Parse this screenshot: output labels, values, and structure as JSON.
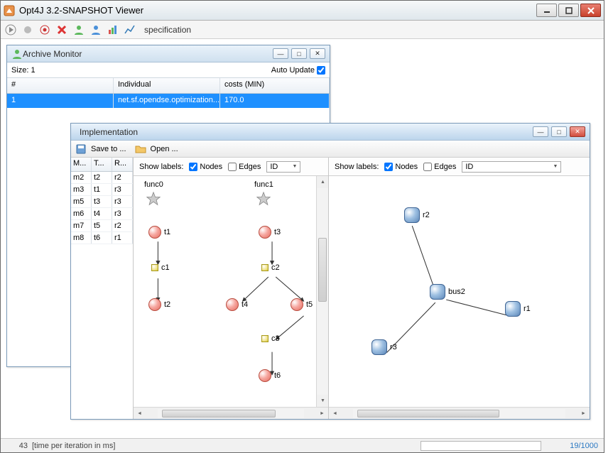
{
  "window": {
    "title": "Opt4J 3.2-SNAPSHOT Viewer"
  },
  "toolbar": {
    "specification_label": "specification"
  },
  "status": {
    "time_value": "43",
    "time_label": "[time per iteration in ms]",
    "progress": "19/1000"
  },
  "archive": {
    "title": "Archive Monitor",
    "size_label": "Size:",
    "size_value": "1",
    "auto_update_label": "Auto Update",
    "columns": {
      "num": "#",
      "individual": "Individual",
      "costs": "costs (MIN)"
    },
    "rows": [
      {
        "num": "1",
        "individual": "net.sf.opendse.optimization...",
        "costs": "170.0"
      }
    ]
  },
  "impl": {
    "title": "Implementation",
    "save_label": "Save to ...",
    "open_label": "Open ...",
    "show_labels": "Show labels:",
    "nodes_label": "Nodes",
    "edges_label": "Edges",
    "id_option": "ID",
    "left_table": {
      "headers": {
        "m": "M...",
        "t": "T...",
        "r": "R..."
      },
      "rows": [
        {
          "m": "m2",
          "t": "t2",
          "r": "r2"
        },
        {
          "m": "m3",
          "t": "t1",
          "r": "r3"
        },
        {
          "m": "m5",
          "t": "t3",
          "r": "r3"
        },
        {
          "m": "m6",
          "t": "t4",
          "r": "r3"
        },
        {
          "m": "m7",
          "t": "t5",
          "r": "r2"
        },
        {
          "m": "m8",
          "t": "t6",
          "r": "r1"
        }
      ]
    },
    "graph1": {
      "funcs": {
        "f0": "func0",
        "f1": "func1"
      },
      "nodes": {
        "t1": "t1",
        "t2": "t2",
        "t3": "t3",
        "t4": "t4",
        "t5": "t5",
        "t6": "t6",
        "c1": "c1",
        "c2": "c2",
        "c3": "c3"
      }
    },
    "graph2": {
      "nodes": {
        "r1": "r1",
        "r2": "r2",
        "r3": "r3",
        "bus2": "bus2"
      }
    }
  }
}
